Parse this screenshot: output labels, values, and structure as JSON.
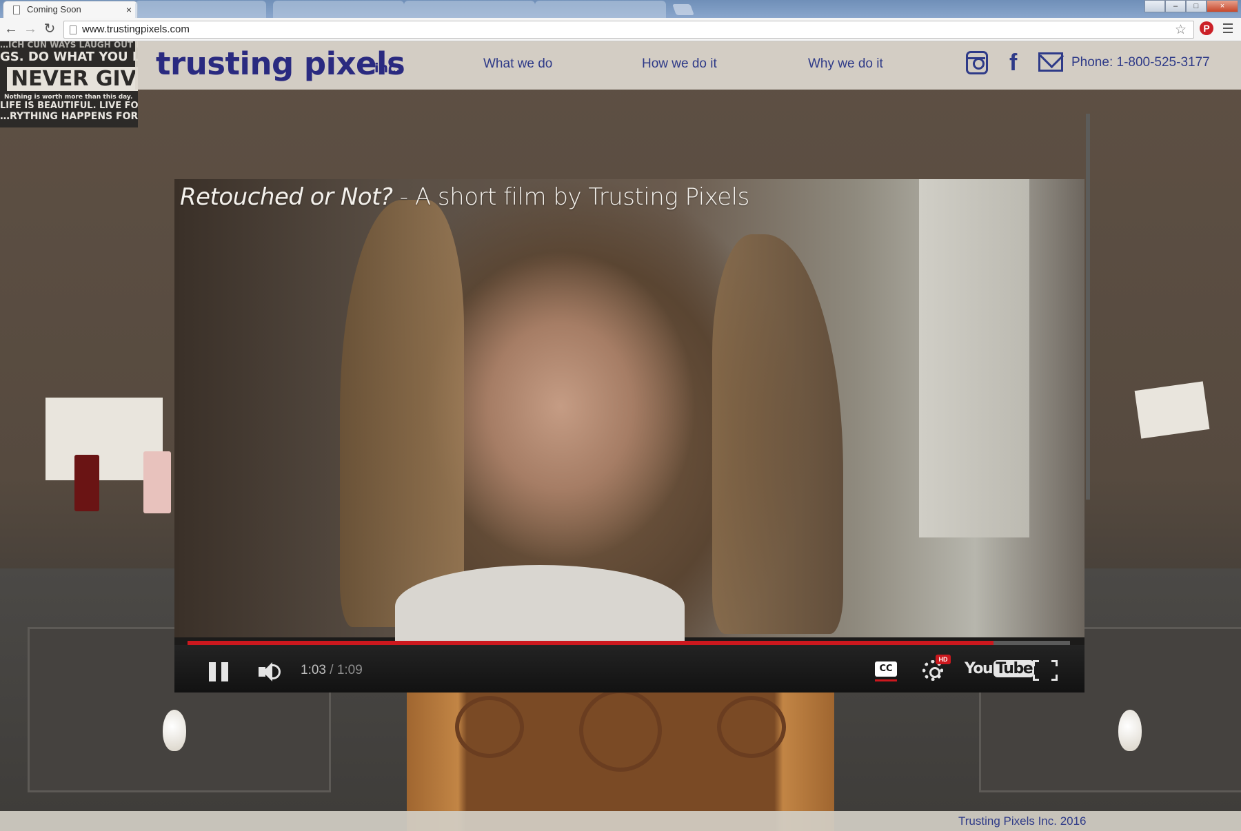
{
  "browser": {
    "active_tab": {
      "title": "Coming Soon",
      "close_glyph": "×"
    },
    "background_tabs": [
      "",
      "",
      "",
      ""
    ],
    "url": "www.trustingpixels.com",
    "window_controls": {
      "user": "",
      "minimize": "–",
      "maximize": "□",
      "close": "×"
    },
    "nav": {
      "back": "←",
      "forward": "→",
      "reload": "↻"
    },
    "bookmark_star": "☆",
    "pinterest": "P"
  },
  "site": {
    "logo": "trusting pixels",
    "logo_suffix": "inc.",
    "nav": [
      {
        "label": "What we do"
      },
      {
        "label": "How we do it"
      },
      {
        "label": "Why we do it"
      }
    ],
    "social": [
      "instagram-icon",
      "facebook-icon",
      "mail-icon"
    ],
    "facebook_glyph": "f",
    "phone": "Phone:  1-800-525-3177",
    "poster_lines": [
      "…ICH CUN WAYS LAUGH OUT LOUD. BE",
      "GS. DO WHAT YOU LOVE.",
      "NEVER GIVE UP.",
      "Nothing is worth more than this day.",
      "LIFE IS BEAUTIFUL. LIVE FOR TODAY.",
      "…RYTHING HAPPENS FOR A REASON."
    ]
  },
  "video": {
    "title_italic": "Retouched or Not?",
    "title_rest": " - A short film by Trusting Pixels",
    "current_time": "1:03",
    "separator": " / ",
    "duration": "1:09",
    "progress_fraction": 0.913,
    "cc_label": "CC",
    "hd_label": "HD",
    "youtube_you": "You",
    "youtube_tube": "Tube"
  },
  "footer": {
    "text": "Trusting Pixels Inc. 2016"
  },
  "colors": {
    "brand_blue": "#2e3a88",
    "youtube_red": "#cc181e"
  }
}
